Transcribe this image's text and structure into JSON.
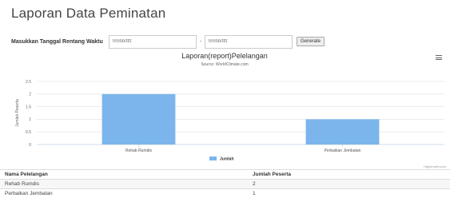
{
  "page": {
    "title": "Laporan Data Peminatan"
  },
  "filter": {
    "label": "Masukkan Tanggal Rentang Waktu",
    "start_placeholder": "hh/bb/tttt",
    "separator": "-",
    "end_placeholder": "hh/bb/tttt",
    "button_label": "Generate"
  },
  "chart_data": {
    "type": "bar",
    "title": "Laporan(report)Pelelangan",
    "subtitle": "Source: WorldClimate.com",
    "ylabel": "Jumlah Peserta",
    "categories": [
      "Rehab Rumdis",
      "Perbaikan Jembatan"
    ],
    "series": [
      {
        "name": "Jumlah",
        "values": [
          2,
          1
        ],
        "color": "#7cb5ec"
      }
    ],
    "ylim": [
      0,
      2.5
    ],
    "yticks": [
      "0",
      "0.5",
      "1",
      "1.5",
      "2",
      "2.5"
    ],
    "grid": true,
    "legend": "bottom-center",
    "credits": "Highcharts.com"
  },
  "table": {
    "headers": [
      "Nama Pelelangan",
      "Jumlah Peserta"
    ],
    "rows": [
      [
        "Rehab Rumdis",
        "2"
      ],
      [
        "Perbaikan Jembatan",
        "1"
      ]
    ]
  }
}
